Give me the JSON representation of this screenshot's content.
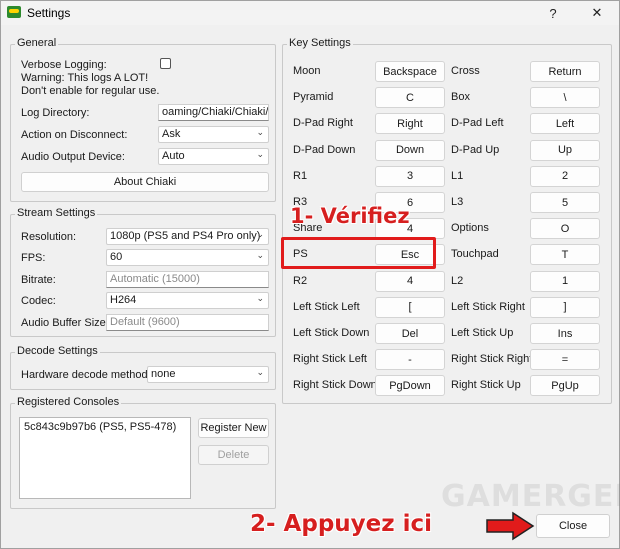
{
  "window": {
    "title": "Settings",
    "help_glyph": "?",
    "close_glyph": "✕"
  },
  "general": {
    "title": "General",
    "verbose_label": "Verbose Logging:",
    "verbose_warning_1": "Warning: This logs A LOT!",
    "verbose_warning_2": "Don't enable for regular use.",
    "verbose_checked": false,
    "log_directory_label": "Log Directory:",
    "log_directory_value": "oaming/Chiaki/Chiaki/log",
    "action_disconnect_label": "Action on Disconnect:",
    "action_disconnect_value": "Ask",
    "audio_output_label": "Audio Output Device:",
    "audio_output_value": "Auto",
    "about_button": "About Chiaki"
  },
  "stream": {
    "title": "Stream Settings",
    "resolution_label": "Resolution:",
    "resolution_value": "1080p (PS5 and PS4 Pro only)",
    "fps_label": "FPS:",
    "fps_value": "60",
    "bitrate_label": "Bitrate:",
    "bitrate_placeholder": "Automatic (15000)",
    "codec_label": "Codec:",
    "codec_value": "H264",
    "audio_buffer_label": "Audio Buffer Size:",
    "audio_buffer_placeholder": "Default (9600)"
  },
  "decode": {
    "title": "Decode Settings",
    "hw_decode_label": "Hardware decode method:",
    "hw_decode_value": "none"
  },
  "consoles": {
    "title": "Registered Consoles",
    "items": [
      "5c843c9b97b6 (PS5, PS5-478)"
    ],
    "register_button": "Register New",
    "delete_button": "Delete"
  },
  "keys": {
    "title": "Key Settings",
    "left": [
      {
        "label": "Moon",
        "key": "Backspace"
      },
      {
        "label": "Pyramid",
        "key": "C"
      },
      {
        "label": "D-Pad Right",
        "key": "Right"
      },
      {
        "label": "D-Pad Down",
        "key": "Down"
      },
      {
        "label": "R1",
        "key": "3"
      },
      {
        "label": "R3",
        "key": "6"
      },
      {
        "label": "Share",
        "key": "4"
      },
      {
        "label": "PS",
        "key": "Esc"
      },
      {
        "label": "R2",
        "key": "4"
      },
      {
        "label": "Left Stick Left",
        "key": "["
      },
      {
        "label": "Left Stick Down",
        "key": "Del"
      },
      {
        "label": "Right Stick Left",
        "key": "-"
      },
      {
        "label": "Right Stick Down",
        "key": "PgDown"
      }
    ],
    "right": [
      {
        "label": "Cross",
        "key": "Return"
      },
      {
        "label": "Box",
        "key": "\\"
      },
      {
        "label": "D-Pad Left",
        "key": "Left"
      },
      {
        "label": "D-Pad Up",
        "key": "Up"
      },
      {
        "label": "L1",
        "key": "2"
      },
      {
        "label": "L3",
        "key": "5"
      },
      {
        "label": "Options",
        "key": "O"
      },
      {
        "label": "Touchpad",
        "key": "T"
      },
      {
        "label": "L2",
        "key": "1"
      },
      {
        "label": "Left Stick Right",
        "key": "]"
      },
      {
        "label": "Left Stick Up",
        "key": "Ins"
      },
      {
        "label": "Right Stick Right",
        "key": "="
      },
      {
        "label": "Right Stick Up",
        "key": "PgUp"
      }
    ]
  },
  "footer": {
    "close_button": "Close"
  },
  "annotations": {
    "step1": "1-  Vérifiez",
    "step2": "2- Appuyez ici",
    "watermark": "GAMERGEN",
    "color": "#e11b1b"
  }
}
